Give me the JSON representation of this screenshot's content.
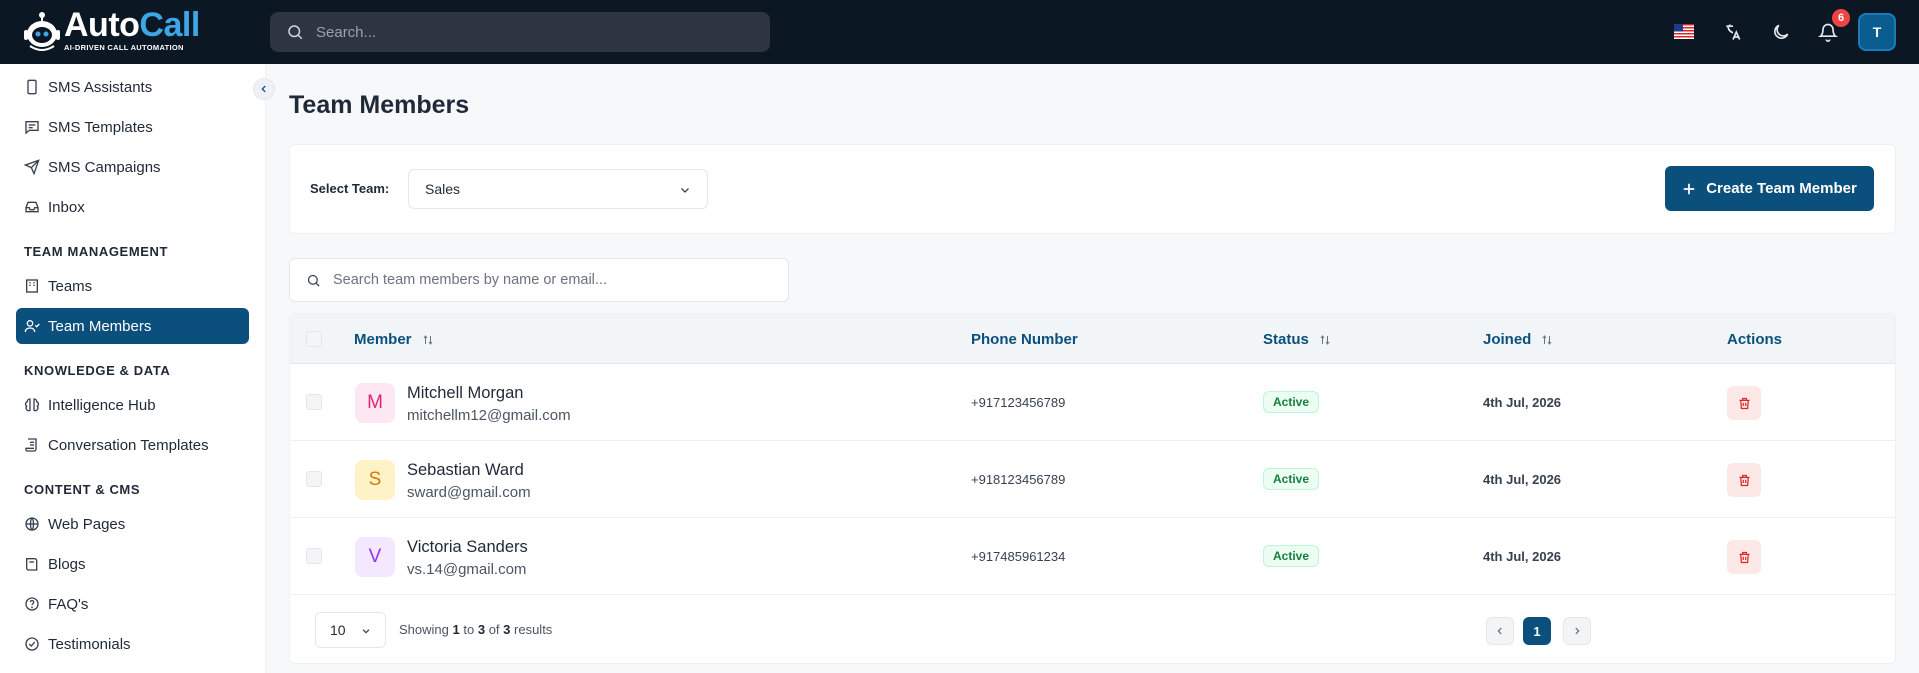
{
  "header": {
    "logo_auto": "Auto",
    "logo_call": "Call",
    "logo_tagline": "AI-DRIVEN CALL AUTOMATION",
    "search_placeholder": "Search...",
    "notification_count": "6",
    "user_initial": "T"
  },
  "sidebar": {
    "items_top": [
      {
        "label": "SMS Assistants",
        "icon": "phone-icon"
      },
      {
        "label": "SMS Templates",
        "icon": "message-icon"
      },
      {
        "label": "SMS Campaigns",
        "icon": "send-icon"
      },
      {
        "label": "Inbox",
        "icon": "inbox-icon"
      }
    ],
    "section_team": "TEAM MANAGEMENT",
    "items_team": [
      {
        "label": "Teams",
        "icon": "building-icon"
      },
      {
        "label": "Team Members",
        "icon": "users-icon",
        "active": true
      }
    ],
    "section_knowledge": "KNOWLEDGE & DATA",
    "items_knowledge": [
      {
        "label": "Intelligence Hub",
        "icon": "brain-icon"
      },
      {
        "label": "Conversation Templates",
        "icon": "scroll-icon"
      }
    ],
    "section_content": "CONTENT & CMS",
    "items_content": [
      {
        "label": "Web Pages",
        "icon": "globe-icon"
      },
      {
        "label": "Blogs",
        "icon": "book-icon"
      },
      {
        "label": "FAQ's",
        "icon": "help-circle-icon"
      },
      {
        "label": "Testimonials",
        "icon": "check-circle-icon"
      }
    ]
  },
  "main": {
    "title": "Team Members",
    "select_team_label": "Select Team:",
    "selected_team": "Sales",
    "create_button": "Create Team Member",
    "member_search_placeholder": "Search team members by name or email...",
    "columns": [
      "Member",
      "Phone Number",
      "Status",
      "Joined",
      "Actions"
    ],
    "rows": [
      {
        "initial": "M",
        "name": "Mitchell Morgan",
        "email": "mitchellm12@gmail.com",
        "phone": "+917123456789",
        "status": "Active",
        "joined": "4th Jul, 2026",
        "avatar_bg": "#fce7f3",
        "avatar_fg": "#db2777"
      },
      {
        "initial": "S",
        "name": "Sebastian Ward",
        "email": "sward@gmail.com",
        "phone": "+918123456789",
        "status": "Active",
        "joined": "4th Jul, 2026",
        "avatar_bg": "#fef3c7",
        "avatar_fg": "#d97706"
      },
      {
        "initial": "V",
        "name": "Victoria Sanders",
        "email": "vs.14@gmail.com",
        "phone": "+917485961234",
        "status": "Active",
        "joined": "4th Jul, 2026",
        "avatar_bg": "#f3e8ff",
        "avatar_fg": "#9333ea"
      }
    ],
    "page_size": "10",
    "showing_prefix": "Showing",
    "showing_from": "1",
    "showing_to_word": "to",
    "showing_to": "3",
    "showing_of_word": "of",
    "showing_total": "3",
    "showing_suffix": "results",
    "current_page": "1"
  },
  "colors": {
    "brand": "#0b4f7c",
    "topbar": "#0b1723",
    "danger": "#ef4444",
    "success": "#15803d"
  }
}
